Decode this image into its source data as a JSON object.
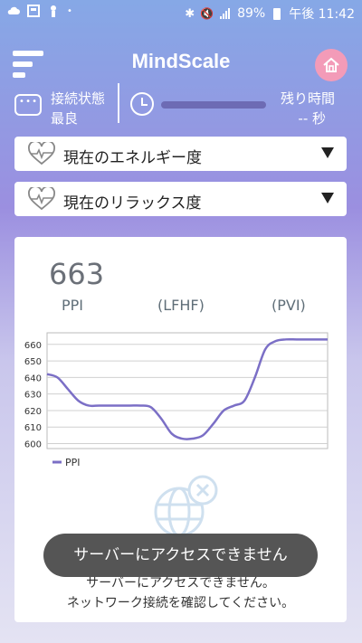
{
  "statusbar": {
    "battery": "89%",
    "time": "午後 11:42"
  },
  "app": {
    "title": "MindScale"
  },
  "connection": {
    "label": "接続状態",
    "value": "最良"
  },
  "remaining": {
    "label": "残り時間",
    "value": "-- 秒"
  },
  "selects": [
    {
      "label": "現在のエネルギー度"
    },
    {
      "label": "現在のリラックス度"
    }
  ],
  "metrics": {
    "current_value": "663",
    "ppi": "PPI",
    "lfhf": "(LFHF)",
    "pvi": "(PVI)"
  },
  "chart_data": {
    "type": "line",
    "series": [
      {
        "name": "PPI",
        "values": [
          642,
          640,
          633,
          626,
          623,
          623,
          623,
          623,
          623,
          623,
          622,
          615,
          606,
          603,
          603,
          605,
          612,
          620,
          623,
          626,
          640,
          657,
          662,
          663,
          663,
          663,
          663,
          663
        ]
      }
    ],
    "yticks": [
      660,
      650,
      640,
      630,
      620,
      610,
      600
    ],
    "ylim": [
      597,
      667
    ],
    "legend": "PPI",
    "color": "#7b6fc6"
  },
  "error": {
    "line1": "サーバーにアクセスできません。",
    "line2": "ネットワーク接続を確認してください。"
  },
  "toast": {
    "message": "サーバーにアクセスできません"
  }
}
